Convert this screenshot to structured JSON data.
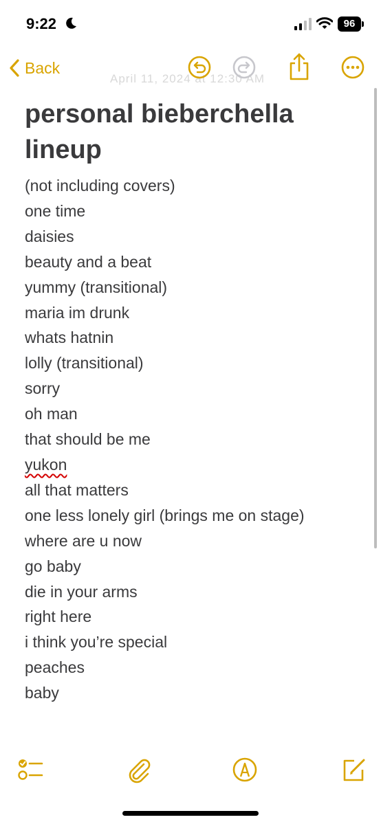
{
  "status_bar": {
    "time": "9:22",
    "battery": "96",
    "icons": [
      "moon-icon",
      "cellular-signal-icon",
      "wifi-icon",
      "battery-icon"
    ]
  },
  "nav": {
    "back_label": "Back",
    "faded_date": "April 11, 2024 at 12:30 AM",
    "icons": [
      "chevron-left-icon",
      "undo-icon",
      "redo-icon",
      "share-icon",
      "more-icon"
    ]
  },
  "note": {
    "title_line1": "personal bieberchella",
    "title_line2": "lineup",
    "lines": [
      "(not including covers)",
      "one time",
      "daisies",
      "beauty and a beat",
      "yummy (transitional)",
      "maria im drunk",
      "whats hatnin",
      "lolly (transitional)",
      "sorry",
      "oh man",
      "that should be me",
      "yukon",
      "all that matters",
      "one less lonely girl (brings me on stage)",
      "where are u now",
      "go baby",
      "die in your arms",
      "right here",
      "i think you’re special",
      "peaches",
      "baby"
    ],
    "misspelled_index": 11
  },
  "toolbar": {
    "icons": [
      "checklist-icon",
      "paperclip-icon",
      "markup-pen-icon",
      "compose-icon"
    ]
  },
  "colors": {
    "accent": "#d9a400",
    "text": "#3a3a3c",
    "background": "#ffffff"
  }
}
